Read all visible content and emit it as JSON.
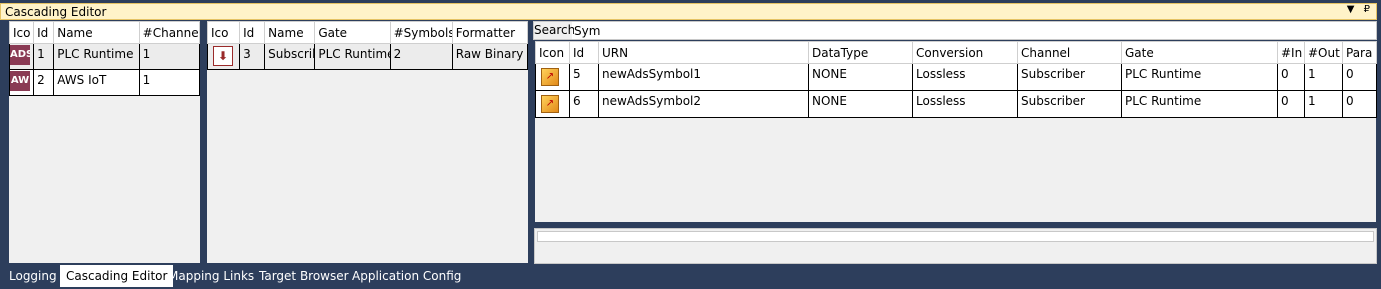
{
  "window": {
    "title": "Cascading Editor"
  },
  "title_buttons": {
    "dropdown": "▼",
    "pin": "₽"
  },
  "channels": {
    "headers": [
      "Ico",
      "Id",
      "Name",
      "#Channel"
    ],
    "rows": [
      {
        "icon": "ADS",
        "id": "1",
        "name": "PLC Runtime",
        "channel": "1"
      },
      {
        "icon": "AW",
        "id": "2",
        "name": "AWS IoT",
        "channel": "1"
      }
    ]
  },
  "subscribers": {
    "headers": [
      "Ico",
      "Id",
      "Name",
      "Gate",
      "#Symbols",
      "Formatter"
    ],
    "rows": [
      {
        "id": "3",
        "name": "Subscrib",
        "gate": "PLC Runtime",
        "symbols": "2",
        "formatter": "Raw Binary"
      }
    ]
  },
  "search": {
    "label": "Search:",
    "value": "Sym"
  },
  "symbols": {
    "headers": [
      "Icon",
      "Id",
      "URN",
      "DataType",
      "Conversion",
      "Channel",
      "Gate",
      "#In",
      "#Out",
      "Para"
    ],
    "rows": [
      {
        "id": "5",
        "urn": "newAdsSymbol1",
        "datatype": "NONE",
        "conversion": "Lossless",
        "channel": "Subscriber",
        "gate": "PLC Runtime",
        "in": "0",
        "out": "1",
        "para": "0"
      },
      {
        "id": "6",
        "urn": "newAdsSymbol2",
        "datatype": "NONE",
        "conversion": "Lossless",
        "channel": "Subscriber",
        "gate": "PLC Runtime",
        "in": "0",
        "out": "1",
        "para": "0"
      }
    ]
  },
  "tabs": [
    "Logging",
    "Cascading Editor",
    "Mapping Links",
    "Target Browser",
    "Application Config"
  ],
  "active_tab": "Cascading Editor",
  "icons": {
    "channel": "ads-icon",
    "subscriber": "arrow-down-icon",
    "symbol": "symbol-icon"
  }
}
